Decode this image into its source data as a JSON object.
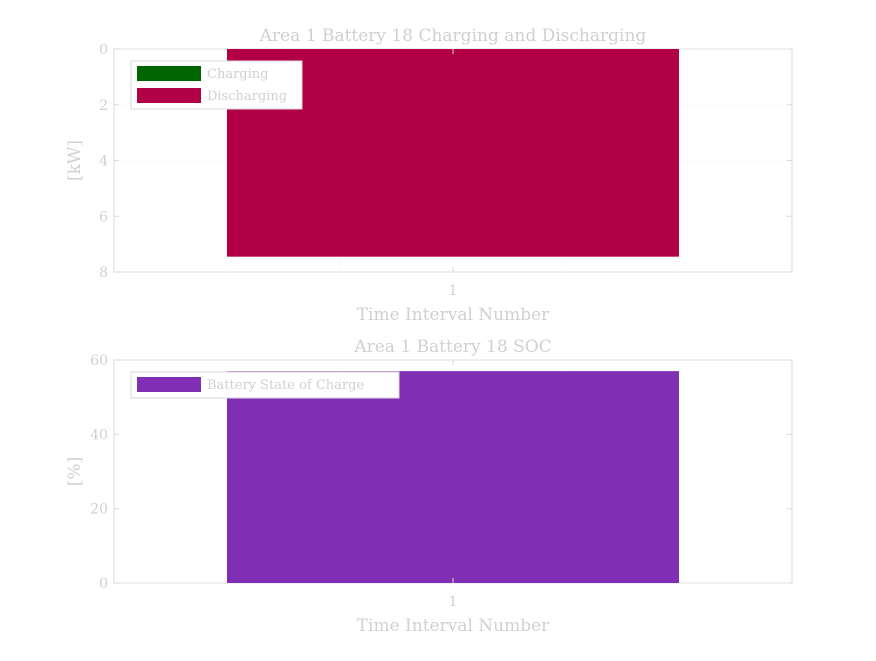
{
  "chart_data": [
    {
      "type": "bar",
      "title": "Area 1 Battery 18 Charging and Discharging",
      "xlabel": "Time Interval Number",
      "ylabel": "[kW]",
      "categories": [
        "1"
      ],
      "series": [
        {
          "name": "Charging",
          "values": [
            0
          ],
          "color": "#006400"
        },
        {
          "name": "Discharging",
          "values": [
            7.45
          ],
          "color": "#b20047"
        }
      ],
      "ylim": [
        0,
        8
      ],
      "y_reversed": true,
      "yticks": [
        0,
        2,
        4,
        6,
        8
      ],
      "grid": true,
      "legend_position": "top-left"
    },
    {
      "type": "bar",
      "title": "Area 1 Battery 18 SOC",
      "xlabel": "Time Interval Number",
      "ylabel": "[%]",
      "categories": [
        "1"
      ],
      "series": [
        {
          "name": "Battery State of Charge",
          "values": [
            57
          ],
          "color": "#7e2fb3"
        }
      ],
      "ylim": [
        0,
        60
      ],
      "y_reversed": false,
      "yticks": [
        0,
        20,
        40,
        60
      ],
      "grid": true,
      "legend_position": "top-left"
    }
  ]
}
